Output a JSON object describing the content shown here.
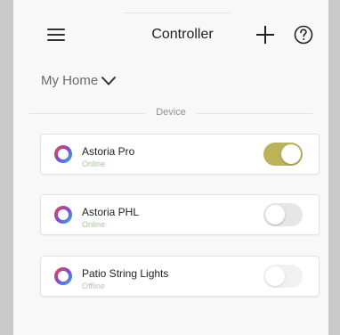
{
  "header": {
    "title": "Controller",
    "menu_icon": "hamburger-menu-icon",
    "add_icon": "plus-icon",
    "help_icon": "help-icon"
  },
  "home_selector": {
    "label": "My Home",
    "icon": "chevron-down-icon"
  },
  "section": {
    "label": "Device"
  },
  "devices": [
    {
      "name": "Astoria Pro",
      "status": "Online",
      "toggle_on": true,
      "enabled": true
    },
    {
      "name": "Astoria PHL",
      "status": "Online",
      "toggle_on": false,
      "enabled": true
    },
    {
      "name": "Patio String Lights",
      "status": "Offline",
      "toggle_on": false,
      "enabled": false
    }
  ],
  "colors": {
    "online": "#a9c39c",
    "offline": "#bdbdbd",
    "toggle_on": "#bbb35a",
    "toggle_off": "#e6e6e6"
  }
}
